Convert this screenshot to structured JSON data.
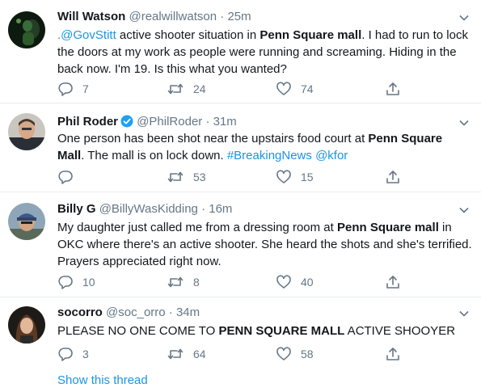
{
  "tweets": [
    {
      "name": "Will Watson",
      "handle": "@realwillwatson",
      "dot": "·",
      "time": "25m",
      "verified": false,
      "lines": [
        [
          {
            "t": ".@GovStitt",
            "s": "link"
          },
          {
            "t": " active shooter situation in "
          },
          {
            "t": "Penn Square mall",
            "s": "bold"
          },
          {
            "t": ". I had to run to lock"
          }
        ],
        [
          {
            "t": "the doors at my work as people were running and screaming. Hiding in the"
          }
        ],
        [
          {
            "t": "back now. I'm 19. Is this what you wanted?"
          }
        ]
      ],
      "replies": "7",
      "retweets": "24",
      "likes": "74"
    },
    {
      "name": "Phil Roder",
      "handle": "@PhilRoder",
      "dot": "·",
      "time": "31m",
      "verified": true,
      "lines": [
        [
          {
            "t": "One person has been shot near the upstairs food court at "
          },
          {
            "t": "Penn Square",
            "s": "bold"
          }
        ],
        [
          {
            "t": "Mall",
            "s": "bold"
          },
          {
            "t": ". The mall is on lock down. "
          },
          {
            "t": "#BreakingNews",
            "s": "link"
          },
          {
            "t": " "
          },
          {
            "t": "@kfor",
            "s": "link"
          }
        ]
      ],
      "replies": "",
      "retweets": "53",
      "likes": "15"
    },
    {
      "name": "Billy G",
      "handle": "@BillyWasKidding",
      "dot": "·",
      "time": "16m",
      "verified": false,
      "lines": [
        [
          {
            "t": "My daughter just called me from a dressing room at "
          },
          {
            "t": "Penn Square mall",
            "s": "bold"
          },
          {
            "t": " in"
          }
        ],
        [
          {
            "t": "OKC where there's an active shooter. She heard the shots and she's terrified."
          }
        ],
        [
          {
            "t": "Prayers appreciated right now."
          }
        ]
      ],
      "replies": "10",
      "retweets": "8",
      "likes": "40"
    },
    {
      "name": "socorro",
      "handle": "@soc_orro",
      "dot": "·",
      "time": "34m",
      "verified": false,
      "lines": [
        [
          {
            "t": "PLEASE NO ONE COME TO "
          },
          {
            "t": "PENN SQUARE MALL",
            "s": "bold"
          },
          {
            "t": " ACTIVE SHOOYER"
          }
        ]
      ],
      "replies": "3",
      "retweets": "64",
      "likes": "58"
    }
  ],
  "show_thread": "Show this thread",
  "colors": {
    "link": "#1b95e0",
    "muted": "#657786",
    "text": "#14171a",
    "divider": "#e6ecf0",
    "verified": "#1da1f2"
  },
  "icons": {
    "reply": "reply-icon",
    "retweet": "retweet-icon",
    "like": "heart-icon",
    "share": "share-icon",
    "caret": "chevron-down-icon",
    "verified": "verified-badge-icon"
  }
}
